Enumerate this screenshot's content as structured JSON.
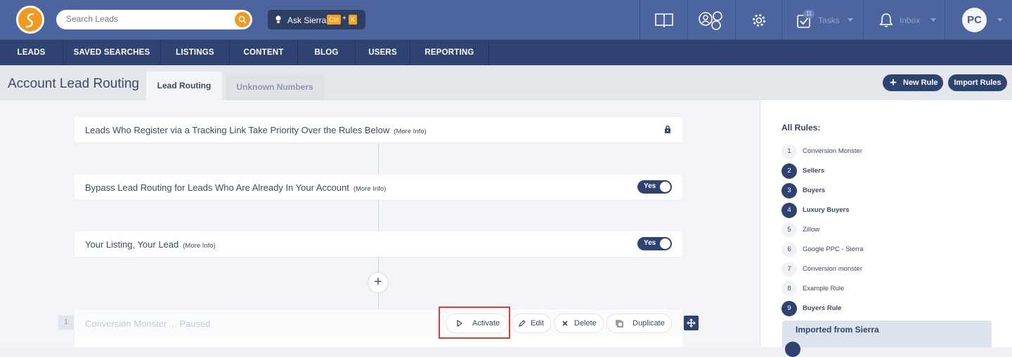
{
  "search": {
    "placeholder": "Search Leads"
  },
  "ask": {
    "label": "Ask Sierra",
    "key1": "Ctrl",
    "plus": "+",
    "key2": "K"
  },
  "header": {
    "tasks_label": "Tasks",
    "tasks_count": "11",
    "inbox_label": "Inbox",
    "avatar": "PC"
  },
  "menu": [
    "LEADS",
    "SAVED SEARCHES",
    "LISTINGS",
    "CONTENT",
    "BLOG",
    "USERS",
    "REPORTING"
  ],
  "page": {
    "title": "Account Lead Routing",
    "tabs": [
      "Lead Routing",
      "Unknown Numbers"
    ],
    "new_rule": "New Rule",
    "import_rules": "Import Rules"
  },
  "cards": [
    {
      "title": "Leads Who Register via a Tracking Link Take Priority Over the Rules Below",
      "more": "(More Info)"
    },
    {
      "title": "Bypass Lead Routing for Leads Who Are Already In Your Account",
      "more": "(More Info)",
      "toggle": "Yes"
    },
    {
      "title": "Your Listing, Your Lead",
      "more": "(More Info)",
      "toggle": "Yes"
    }
  ],
  "add_symbol": "+",
  "rule": {
    "number": "1",
    "title": "Conversion Monster ... Paused",
    "actions": [
      "Activate",
      "Edit",
      "Delete",
      "Duplicate"
    ]
  },
  "sidebar": {
    "heading": "All Rules:",
    "rules": [
      {
        "num": "1",
        "label": "Conversion Monster",
        "active": false
      },
      {
        "num": "2",
        "label": "Sellers",
        "active": true
      },
      {
        "num": "3",
        "label": "Buyers",
        "active": true
      },
      {
        "num": "4",
        "label": "Luxury Buyers",
        "active": true
      },
      {
        "num": "5",
        "label": "Zillow",
        "active": false
      },
      {
        "num": "6",
        "label": "Google PPC - Sierra",
        "active": false
      },
      {
        "num": "7",
        "label": "Conversion monster",
        "active": false
      },
      {
        "num": "8",
        "label": "Example Rule",
        "active": false
      },
      {
        "num": "9",
        "label": "Buyers Rule",
        "active": true
      }
    ],
    "imported_heading": "Imported from Sierra"
  },
  "colors": {
    "brand_orange": "#f39a1e",
    "topbar": "#4c659e",
    "navbar": "#2f4372",
    "highlight": "#e03c3c"
  }
}
